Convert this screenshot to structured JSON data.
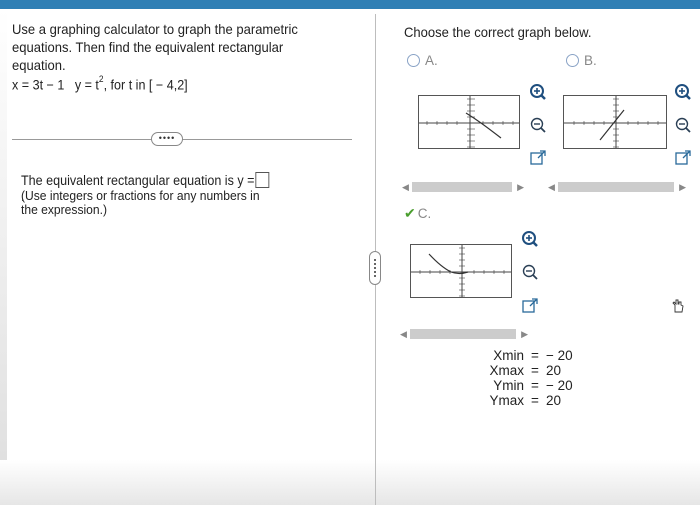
{
  "left": {
    "prompt": "Use a graphing calculator to graph the parametric equations. Then find the equivalent rectangular equation.",
    "equation_x": "x = 3t − 1",
    "equation_y": "y = t",
    "equation_y_exp": "2",
    "equation_range": ", for t in [ − 4,2]",
    "more_label": "••••",
    "answer_prefix": "The equivalent rectangular equation is y =",
    "answer_suffix": ".",
    "hint": "(Use integers or fractions for any numbers in the expression.)"
  },
  "right": {
    "instruction": "Choose the correct graph below.",
    "options": [
      {
        "label": "A.",
        "selected": false
      },
      {
        "label": "B.",
        "selected": false
      },
      {
        "label": "C.",
        "selected": true
      }
    ],
    "window": [
      {
        "key": "Xmin",
        "value": "− 20"
      },
      {
        "key": "Xmax",
        "value": "20"
      },
      {
        "key": "Ymin",
        "value": "− 20"
      },
      {
        "key": "Ymax",
        "value": "20"
      }
    ]
  },
  "colors": {
    "topbar": "#2f7fb5",
    "check": "#4a9e2e",
    "zoom_icon": "#1f4f7f"
  },
  "icons": [
    "zoom-in-icon",
    "zoom-out-icon",
    "external-link-icon",
    "checkmark-icon",
    "hand-cursor-icon"
  ]
}
